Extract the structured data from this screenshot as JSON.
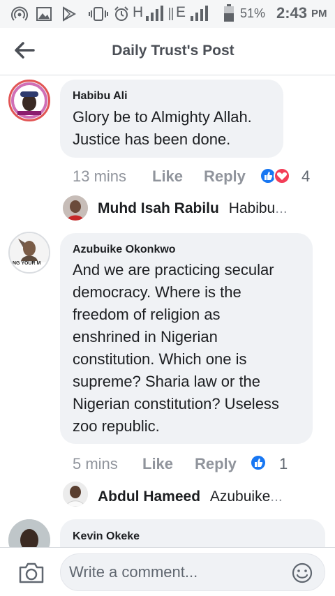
{
  "status_bar": {
    "network_left": "H",
    "network_right": "E",
    "battery": "51%",
    "time": "2:43",
    "ampm": "PM"
  },
  "header": {
    "title": "Daily Trust's Post"
  },
  "comments": [
    {
      "author": "Habibu Ali",
      "text_lines": [
        "Glory be to Almighty Allah.",
        "Justice has been done."
      ],
      "time": "13 mins",
      "like_label": "Like",
      "reply_label": "Reply",
      "reaction_count": "4",
      "reply_preview": {
        "name": "Muhd Isah Rabilu",
        "text": "Habibu",
        "ellipsis": "..."
      }
    },
    {
      "author": "Azubuike Okonkwo",
      "text_lines": [
        "And we are practicing secular",
        "democracy. Where is the",
        "freedom of religion as",
        "enshrined in Nigerian",
        "constitution. Which one is",
        "supreme? Sharia law or the",
        "Nigerian constitution? Useless",
        "zoo republic."
      ],
      "time": "5 mins",
      "like_label": "Like",
      "reply_label": "Reply",
      "reaction_count": "1",
      "avatar_caption": "NG YOUR M",
      "reply_preview": {
        "name": "Abdul Hameed",
        "text": "Azubuike",
        "ellipsis": "..."
      }
    },
    {
      "author": "Kevin Okeke"
    }
  ],
  "composer": {
    "placeholder": "Write a comment..."
  },
  "colors": {
    "like_blue": "#1877f2",
    "love_red": "#f33e58",
    "bubble_gray": "#f0f2f5",
    "meta_gray": "#90949c"
  }
}
